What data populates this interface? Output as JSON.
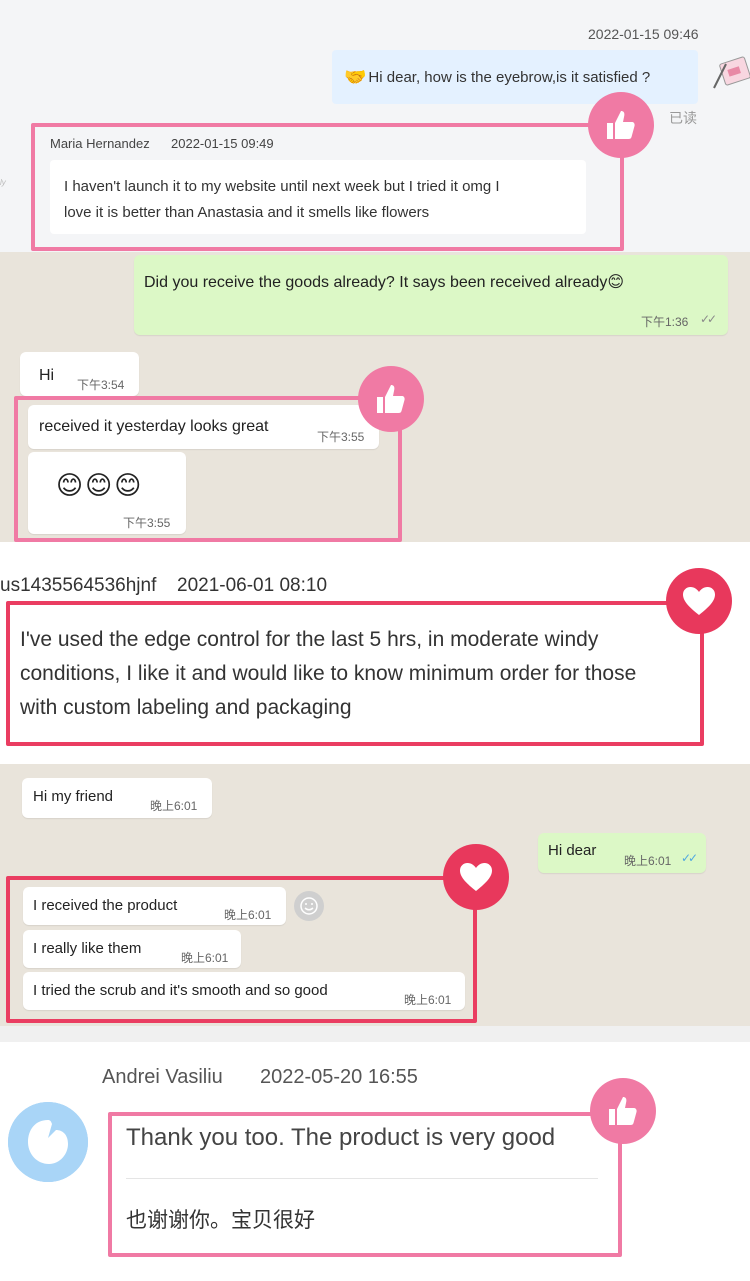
{
  "review1": {
    "top_timestamp": "2022-01-15 09:46",
    "outgoing_icon": "handshake-emoji",
    "outgoing_message": "Hi dear, how is the eyebrow,is it satisfied ?",
    "read_status": "已读",
    "reviewer_name": "Maria Hernandez",
    "reviewer_timestamp": "2022-01-15 09:49",
    "reply_line1": "I haven't launch it to my website until next week but I tried it omg I",
    "reply_line2": "love it is better than Anastasia and it smells like flowers"
  },
  "chat1": {
    "outgoing_message": "Did you receive the goods already? It says been received already😊",
    "outgoing_time": "下午1:36",
    "incoming": [
      {
        "text": "Hi",
        "time": "下午3:54"
      },
      {
        "text": "received it yesterday looks great",
        "time": "下午3:55"
      },
      {
        "text": "😊😊😊",
        "time": "下午3:55"
      }
    ]
  },
  "review2": {
    "username": "us1435564536hjnf",
    "timestamp": "2021-06-01 08:10",
    "line1": "I've used the edge control for the last 5 hrs, in moderate windy",
    "line2": "conditions, I like it and would like to know minimum order for those",
    "line3": "with custom labeling and packaging"
  },
  "chat2": {
    "first_incoming": {
      "text": "Hi my friend",
      "time": "晚上6:01"
    },
    "outgoing": {
      "text": "Hi dear",
      "time": "晚上6:01"
    },
    "incoming": [
      {
        "text": "I received the product",
        "time": "晚上6:01"
      },
      {
        "text": "I really like them",
        "time": "晚上6:01"
      },
      {
        "text": "I tried the scrub and it's smooth and so good",
        "time": "晚上6:01"
      }
    ]
  },
  "review3": {
    "reviewer_name": "Andrei Vasiliu",
    "timestamp": "2022-05-20 16:55",
    "text_en": "Thank you too. The product is very good",
    "text_zh": "也谢谢你。宝贝很好"
  },
  "colors": {
    "pink_frame": "#f07aa4",
    "red_frame": "#ea3d61",
    "whatsapp_green": "#dcf8c6",
    "chat_background": "#e9e4db",
    "read_ticks": "#4fa8e0"
  },
  "icons": {
    "thumbs_up": "thumbs-up-icon",
    "heart": "heart-icon",
    "smiley": "smiley-icon",
    "avatar": "avatar-icon"
  }
}
